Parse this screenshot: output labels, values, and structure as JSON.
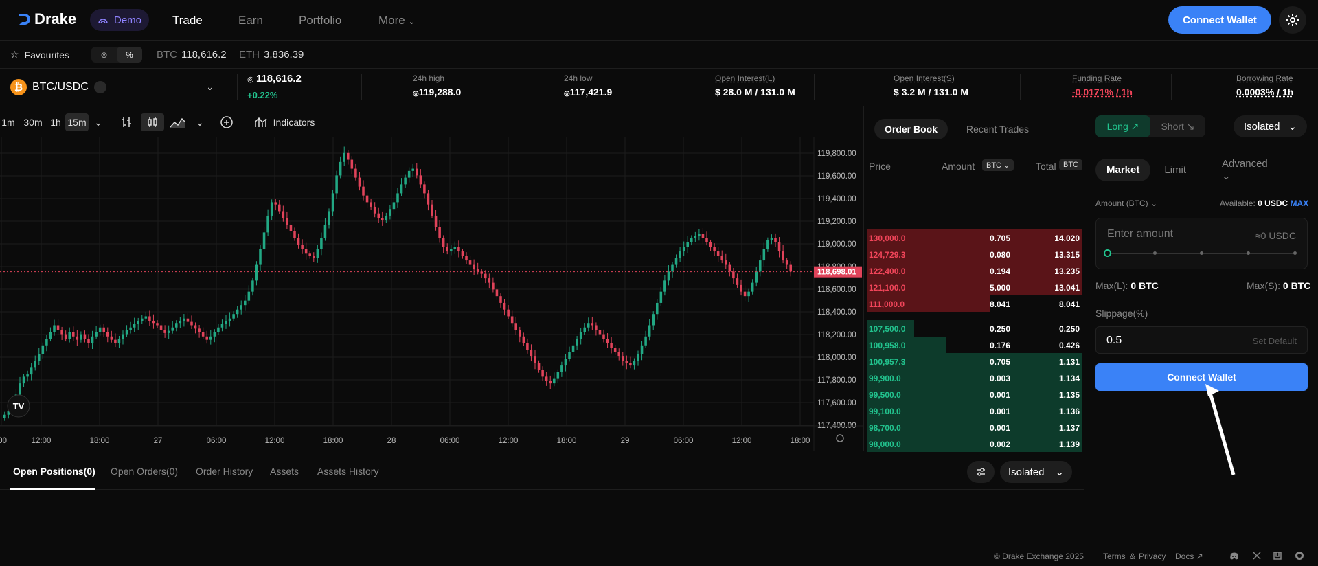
{
  "nav": {
    "brand": "Drake",
    "demo_label": "Demo",
    "links": [
      "Trade",
      "Earn",
      "Portfolio",
      "More"
    ],
    "connect_label": "Connect Wallet",
    "accent": "#3a82f7"
  },
  "favbar": {
    "label": "Favourites",
    "toggle": [
      "⊗",
      "%"
    ],
    "tickers": [
      {
        "sym": "BTC",
        "price": "118,616.2"
      },
      {
        "sym": "ETH",
        "price": "3,836.39"
      }
    ]
  },
  "market": {
    "pair": "BTC/USDC",
    "price": "118,616.2",
    "change": "+0.22%",
    "high_label": "24h high",
    "high": "119,288.0",
    "low_label": "24h low",
    "low": "117,421.9",
    "oil_label": "Open Interest(L)",
    "oil": "28.0 M / 131.0 M",
    "ois_label": "Open Interest(S)",
    "ois": "3.2 M / 131.0 M",
    "fr_label": "Funding Rate",
    "fr": "-0.0171% / 1h",
    "br_label": "Borrowing Rate",
    "br": "0.0003% / 1h",
    "up_color": "#22c38e",
    "down_color": "#f2455a"
  },
  "chart": {
    "intervals": [
      "1m",
      "30m",
      "1h",
      "15m"
    ],
    "indicators_label": "Indicators",
    "y_ticks": [
      "119,800.00",
      "119,600.00",
      "119,400.00",
      "119,200.00",
      "119,000.00",
      "118,800.00",
      "118,600.00",
      "118,400.00",
      "118,200.00",
      "118,000.00",
      "117,800.00",
      "117,600.00",
      "117,400.00"
    ],
    "x_ticks": [
      ":00",
      "12:00",
      "18:00",
      "27",
      "06:00",
      "12:00",
      "18:00",
      "28",
      "06:00",
      "12:00",
      "18:00",
      "29",
      "06:00",
      "12:00",
      "18:00"
    ],
    "last_price": "118,698.01",
    "tv_logo": "TV"
  },
  "chart_data": {
    "type": "candlestick",
    "y_range": [
      117320,
      119900
    ],
    "last": 118698.01,
    "closes": [
      117420,
      117450,
      117520,
      117600,
      117700,
      117760,
      117780,
      117840,
      117900,
      117960,
      118040,
      118100,
      118160,
      118220,
      118180,
      118140,
      118100,
      118160,
      118120,
      118090,
      118140,
      118100,
      118060,
      118120,
      118160,
      118200,
      118160,
      118120,
      118090,
      118060,
      118100,
      118140,
      118180,
      118200,
      118230,
      118260,
      118280,
      118300,
      118260,
      118240,
      118220,
      118180,
      118150,
      118170,
      118200,
      118240,
      118260,
      118280,
      118250,
      118220,
      118190,
      118160,
      118120,
      118090,
      118120,
      118160,
      118200,
      118230,
      118260,
      118280,
      118320,
      118360,
      118400,
      118440,
      118520,
      118620,
      118760,
      118900,
      119050,
      119200,
      119320,
      119300,
      119240,
      119180,
      119120,
      119060,
      119000,
      118940,
      118900,
      118860,
      118840,
      118820,
      118900,
      119000,
      119120,
      119240,
      119400,
      119560,
      119680,
      119760,
      119700,
      119620,
      119540,
      119460,
      119380,
      119320,
      119280,
      119220,
      119180,
      119160,
      119200,
      119260,
      119320,
      119400,
      119480,
      119540,
      119600,
      119620,
      119560,
      119480,
      119400,
      119300,
      119200,
      119100,
      119000,
      118920,
      118880,
      118900,
      118920,
      118880,
      118840,
      118800,
      118760,
      118720,
      118700,
      118680,
      118640,
      118600,
      118540,
      118480,
      118420,
      118360,
      118300,
      118240,
      118180,
      118120,
      118060,
      118000,
      117940,
      117880,
      117820,
      117760,
      117720,
      117700,
      117740,
      117800,
      117860,
      117920,
      117980,
      118040,
      118100,
      118160,
      118200,
      118240,
      118220,
      118180,
      118140,
      118100,
      118060,
      118020,
      117980,
      117940,
      117900,
      117880,
      117860,
      117900,
      117960,
      118040,
      118120,
      118220,
      118320,
      118420,
      118520,
      118620,
      118700,
      118760,
      118820,
      118880,
      118920,
      118960,
      119000,
      119020,
      119040,
      119000,
      118960,
      118920,
      118880,
      118840,
      118800,
      118760,
      118700,
      118640,
      118580,
      118520,
      118480,
      118520,
      118600,
      118700,
      118800,
      118900,
      118980,
      119000,
      118960,
      118880,
      118800,
      118760,
      118700
    ]
  },
  "orderbook": {
    "tabs": [
      "Order Book",
      "Recent Trades"
    ],
    "headers": {
      "price": "Price",
      "amount": "Amount",
      "total": "Total",
      "unit": "BTC"
    },
    "asks": [
      {
        "price": "130,000.0",
        "amount": "0.705",
        "total": "14.020",
        "depth": 1.0
      },
      {
        "price": "124,729.3",
        "amount": "0.080",
        "total": "13.315",
        "depth": 1.0
      },
      {
        "price": "122,400.0",
        "amount": "0.194",
        "total": "13.235",
        "depth": 1.0
      },
      {
        "price": "121,100.0",
        "amount": "5.000",
        "total": "13.041",
        "depth": 1.0
      },
      {
        "price": "111,000.0",
        "amount": "8.041",
        "total": "8.041",
        "depth": 0.57
      }
    ],
    "bids": [
      {
        "price": "107,500.0",
        "amount": "0.250",
        "total": "0.250",
        "depth": 0.22
      },
      {
        "price": "100,958.0",
        "amount": "0.176",
        "total": "0.426",
        "depth": 0.37
      },
      {
        "price": "100,957.3",
        "amount": "0.705",
        "total": "1.131",
        "depth": 1.0
      },
      {
        "price": "99,900.0",
        "amount": "0.003",
        "total": "1.134",
        "depth": 1.0
      },
      {
        "price": "99,500.0",
        "amount": "0.001",
        "total": "1.135",
        "depth": 1.0
      },
      {
        "price": "99,100.0",
        "amount": "0.001",
        "total": "1.136",
        "depth": 1.0
      },
      {
        "price": "98,700.0",
        "amount": "0.001",
        "total": "1.137",
        "depth": 1.0
      },
      {
        "price": "98,000.0",
        "amount": "0.002",
        "total": "1.139",
        "depth": 1.0
      }
    ]
  },
  "trade": {
    "long": "Long ↗",
    "short": "Short ↘",
    "margin_mode": "Isolated",
    "order_types": [
      "Market",
      "Limit",
      "Advanced"
    ],
    "amount_label": "Amount (BTC)",
    "available_label": "Available:",
    "available_value": "0 USDC",
    "max_label": "MAX",
    "amount_placeholder": "Enter amount",
    "approx": "≈0 USDC",
    "maxl_label": "Max(L):",
    "maxl_value": "0 BTC",
    "maxs_label": "Max(S):",
    "maxs_value": "0 BTC",
    "slippage_label": "Slippage(%)",
    "slippage_value": "0.5",
    "set_default": "Set Default",
    "connect_label": "Connect Wallet"
  },
  "bottom": {
    "tabs": [
      "Open Positions(0)",
      "Open Orders(0)",
      "Order History",
      "Assets",
      "Assets History"
    ],
    "margin_mode": "Isolated"
  },
  "footer": {
    "copyright": "© Drake Exchange 2025",
    "terms": "Terms",
    "amp": "&",
    "privacy": "Privacy",
    "docs": "Docs"
  }
}
